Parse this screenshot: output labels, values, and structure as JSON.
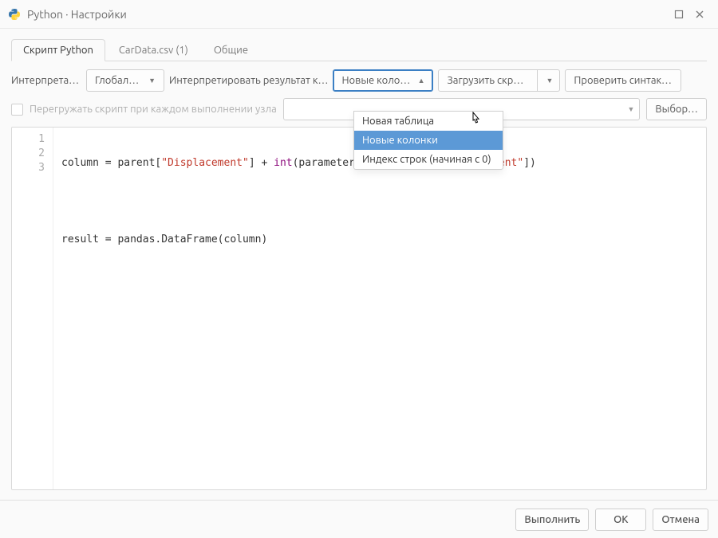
{
  "window": {
    "title": "Python · Настройки"
  },
  "tabs": [
    {
      "label": "Скрипт Python",
      "active": true
    },
    {
      "label": "CarData.csv (1)",
      "active": false
    },
    {
      "label": "Общие",
      "active": false
    }
  ],
  "toolbar": {
    "interpreter_label": "Интерпретат…",
    "interpreter_value": "Глобальн…",
    "interpret_result_label": "Интерпретировать результат к…",
    "result_as_value": "Новые колон…",
    "load_script_label": "Загрузить скрип…",
    "check_syntax_label": "Проверить синтакс…"
  },
  "checkbox_row": {
    "label": "Перегружать скрипт при каждом выполнении узла",
    "choose_button": "Выбор…"
  },
  "dropdown": {
    "options": [
      "Новая таблица",
      "Новые колонки",
      "Индекс строк (начиная с 0)"
    ],
    "selected_index": 1
  },
  "code": {
    "lines": [
      1,
      2,
      3
    ],
    "line1_a": "column = parent[",
    "line1_str": "\"Displacement\"",
    "line1_b": "] + ",
    "line1_builtin": "int",
    "line1_c": "(parameters[",
    "line1_str2": "\"additional_displacement\"",
    "line1_d": "])",
    "line2": "",
    "line3": "result = pandas.DataFrame(column)"
  },
  "footer": {
    "execute": "Выполнить",
    "ok": "OK",
    "cancel": "Отмена"
  }
}
